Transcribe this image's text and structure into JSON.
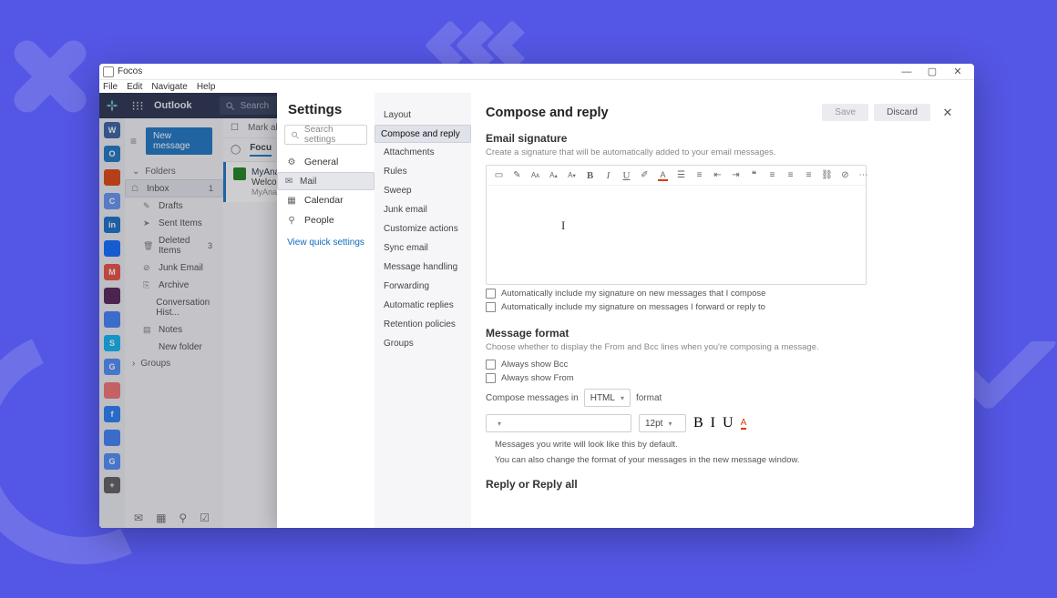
{
  "window": {
    "title": "Focos",
    "min": "—",
    "max": "▢",
    "close": "✕"
  },
  "menubar": [
    "File",
    "Edit",
    "Navigate",
    "Help"
  ],
  "header": {
    "app": "Outlook",
    "search_placeholder": "Search",
    "icons": [
      "user",
      "sync",
      "settings",
      "help"
    ]
  },
  "rail": [
    {
      "label": "W",
      "bg": "#2b579a"
    },
    {
      "label": "O",
      "bg": "#0f6cbd"
    },
    {
      "label": "",
      "bg": "#da3b01"
    },
    {
      "label": "C",
      "bg": "#5b8def"
    },
    {
      "label": "in",
      "bg": "#0a66c2"
    },
    {
      "label": "",
      "bg": "#0061ff"
    },
    {
      "label": "M",
      "bg": "#ea4335"
    },
    {
      "label": "",
      "bg": "#4a154b"
    },
    {
      "label": "",
      "bg": "#3478f6"
    },
    {
      "label": "S",
      "bg": "#00aff0"
    },
    {
      "label": "G",
      "bg": "#4285f4"
    },
    {
      "label": "",
      "bg": "#f06a6a"
    },
    {
      "label": "f",
      "bg": "#1877f2"
    },
    {
      "label": "",
      "bg": "#3478f6"
    },
    {
      "label": "G",
      "bg": "#4285f4"
    },
    {
      "label": "+",
      "bg": "#555"
    }
  ],
  "nav": {
    "new_message": "New message",
    "folders_label": "Folders",
    "items": [
      {
        "icon": "inbox",
        "label": "Inbox",
        "count": "1",
        "sel": true
      },
      {
        "icon": "draft",
        "label": "Drafts"
      },
      {
        "icon": "sent",
        "label": "Sent Items"
      },
      {
        "icon": "del",
        "label": "Deleted Items",
        "count": "3"
      },
      {
        "icon": "junk",
        "label": "Junk Email"
      },
      {
        "icon": "arch",
        "label": "Archive"
      },
      {
        "icon": "",
        "label": "Conversation Hist..."
      },
      {
        "icon": "note",
        "label": "Notes"
      },
      {
        "icon": "",
        "label": "New folder"
      }
    ],
    "groups_label": "Groups"
  },
  "msglist": {
    "markall": "Mark all as",
    "tabs": [
      "Focu"
    ],
    "item": {
      "from": "MyAnaly",
      "subject": "Welcome",
      "preview": "MyAnal"
    }
  },
  "bottombar_icons": [
    "mail",
    "calendar",
    "people",
    "todo"
  ],
  "settings": {
    "title": "Settings",
    "search_placeholder": "Search settings",
    "categories": [
      {
        "icon": "⚙",
        "label": "General"
      },
      {
        "icon": "✉",
        "label": "Mail",
        "sel": true
      },
      {
        "icon": "▦",
        "label": "Calendar"
      },
      {
        "icon": "⚲",
        "label": "People"
      }
    ],
    "view_quick": "View quick settings",
    "subnav": [
      "Layout",
      "Compose and reply",
      "Attachments",
      "Rules",
      "Sweep",
      "Junk email",
      "Customize actions",
      "Sync email",
      "Message handling",
      "Forwarding",
      "Automatic replies",
      "Retention policies",
      "Groups"
    ],
    "subnav_selected": 1
  },
  "pane": {
    "title": "Compose and reply",
    "save": "Save",
    "discard": "Discard",
    "sig_heading": "Email signature",
    "sig_desc": "Create a signature that will be automatically added to your email messages.",
    "chk1": "Automatically include my signature on new messages that I compose",
    "chk2": "Automatically include my signature on messages I forward or reply to",
    "fmt_heading": "Message format",
    "fmt_desc": "Choose whether to display the From and Bcc lines when you're composing a message.",
    "bcc": "Always show Bcc",
    "from": "Always show From",
    "compose_in_pre": "Compose messages in",
    "compose_fmt": "HTML",
    "compose_in_post": "format",
    "size": "12pt",
    "note1": "Messages you write will look like this by default.",
    "note2": "You can also change the format of your messages in the new message window.",
    "reply_heading": "Reply or Reply all"
  }
}
